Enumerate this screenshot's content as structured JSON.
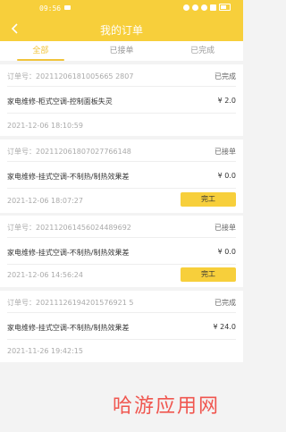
{
  "status_bar": {
    "time": "09:56"
  },
  "header": {
    "title": "我的订单"
  },
  "tabs": [
    {
      "label": "全部"
    },
    {
      "label": "已接单"
    },
    {
      "label": "已完成"
    }
  ],
  "orders": [
    {
      "order_no": "订单号：20211206181005665 2807",
      "status": "已完成",
      "service": "家电维修-柜式空调-控制面板失灵",
      "price": "¥ 2.0",
      "date": "2021-12-06 18:10:59",
      "action": ""
    },
    {
      "order_no": "订单号：202112061807027766148",
      "status": "已接单",
      "service": "家电维修-挂式空调-不制热/制热效果差",
      "price": "¥ 0.0",
      "date": "2021-12-06 18:07:27",
      "action": "完工"
    },
    {
      "order_no": "订单号：202112061456024489692",
      "status": "已接单",
      "service": "家电维修-挂式空调-不制热/制热效果差",
      "price": "¥ 0.0",
      "date": "2021-12-06 14:56:24",
      "action": "完工"
    },
    {
      "order_no": "订单号：20211126194201576921 5",
      "status": "已完成",
      "service": "家电维修-挂式空调-不制热/制热效果差",
      "price": "¥ 24.0",
      "date": "2021-11-26 19:42:15",
      "action": ""
    }
  ],
  "watermark": "哈游应用网",
  "colors": {
    "brand": "#f7cf3b",
    "tab_active": "#f1c43b",
    "watermark": "#f0564f"
  }
}
